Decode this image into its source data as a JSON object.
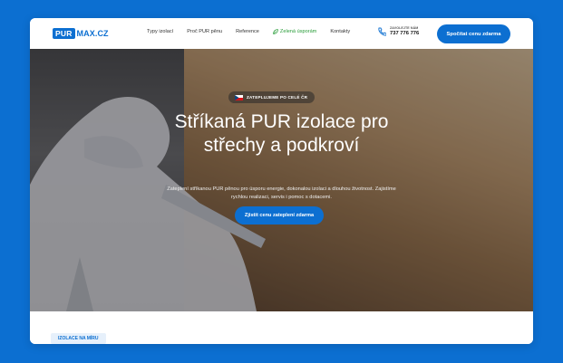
{
  "header": {
    "logo_pur": "PUR",
    "logo_max": "MAX.CZ",
    "nav": [
      "Typy izolací",
      "Proč PUR pěnu",
      "Reference",
      "Zelená úsporám",
      "Kontakty"
    ],
    "phone_label": "ZAVOLEJTE NÁM",
    "phone_number": "737 776 776",
    "cta": "Spočítat cenu zdarma"
  },
  "hero": {
    "badge": "ZATEPLUJEME PO CELÉ ČR",
    "title_line1": "Stříkaná PUR izolace pro",
    "title_line2": "střechy a podkroví",
    "lead": "Zateplení stříkanou PUR pěnou pro úsporu energie, dokonalou izolaci a dlouhou životnost. Zajistíme rychlou realizaci, servis i pomoc s dotacemi.",
    "cta": "Zjistit cenu zateplení zdarma"
  },
  "lower": {
    "chip": "IZOLACE NA MÍRU"
  },
  "colors": {
    "brand_blue": "#0c6fd1",
    "green": "#2a9d3a"
  }
}
